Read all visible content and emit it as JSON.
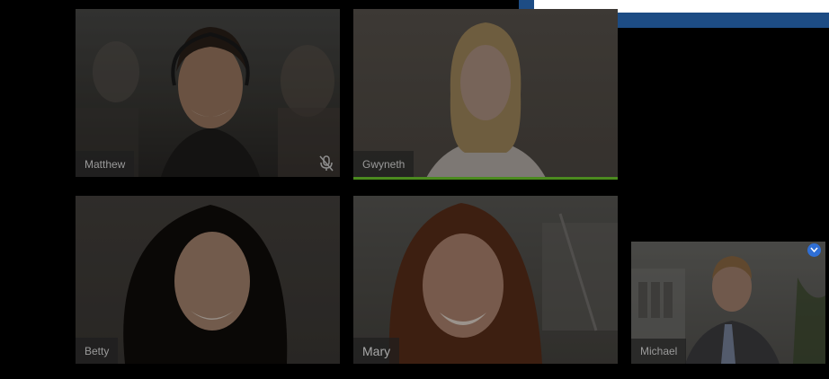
{
  "participants": [
    {
      "name": "Matthew",
      "muted": true,
      "speaking": false
    },
    {
      "name": "Gwyneth",
      "muted": false,
      "speaking": true
    },
    {
      "name": "Betty",
      "muted": false,
      "speaking": false
    },
    {
      "name": "Mary",
      "muted": false,
      "speaking": false
    },
    {
      "name": "Michael",
      "muted": false,
      "speaking": false,
      "pinned": true
    }
  ],
  "colors": {
    "background": "#000000",
    "top_panel": "#1d4c84",
    "speaking_indicator": "#4b8a1f",
    "pin_badge": "#2f6fd6"
  }
}
